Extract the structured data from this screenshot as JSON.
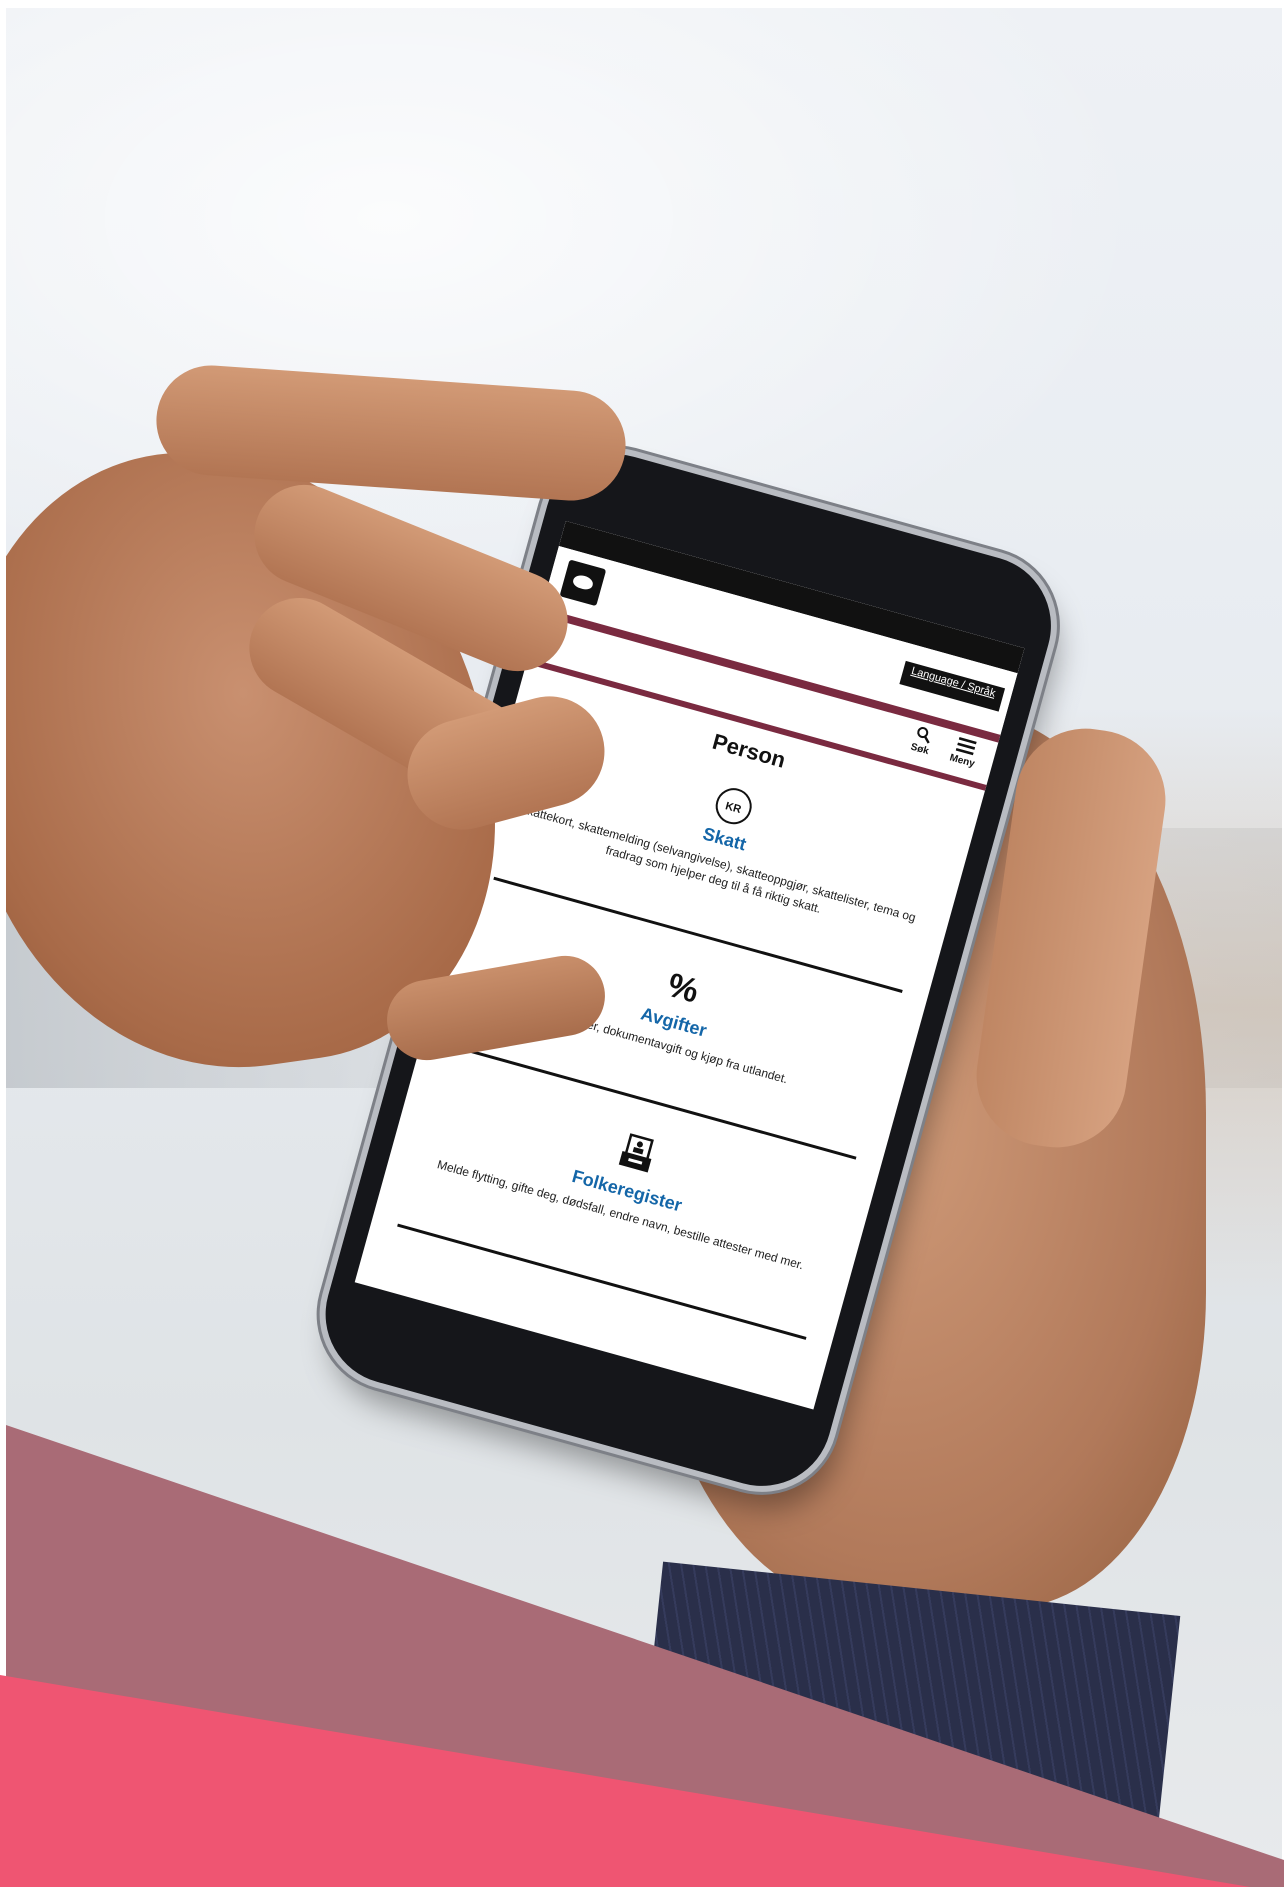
{
  "site": {
    "language_link": "Language / Språk",
    "search_label": "Søk",
    "menu_label": "Meny",
    "page_title": "Person"
  },
  "cards": [
    {
      "icon": "kr-icon",
      "icon_text": "KR",
      "title": "Skatt",
      "description": "Skattekort, skattemelding (selvangivelse), skatteoppgjør, skattelister, tema og fradrag som hjelper deg til å få riktig skatt."
    },
    {
      "icon": "percent-icon",
      "icon_text": "%",
      "title": "Avgifter",
      "description": "Bilavgifter, dokumentavgift og kjøp fra utlandet."
    },
    {
      "icon": "registry-icon",
      "title": "Folkeregister",
      "description": "Melde flytting, gifte deg, dødsfall, endre navn, bestille attester med mer."
    }
  ],
  "colors": {
    "accent_stripe": "#7a2a40",
    "link_blue": "#1466a8",
    "band_mauve": "#a96b76",
    "band_pink": "#ef5572"
  }
}
